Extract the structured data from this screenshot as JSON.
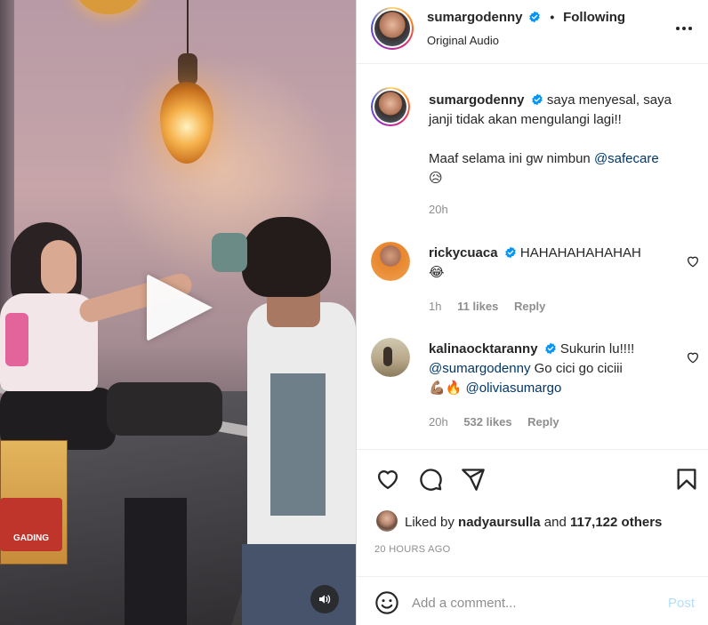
{
  "media": {
    "box_text": "GADING",
    "controls": {
      "play_icon": "play-icon",
      "audio_icon": "speaker-icon"
    }
  },
  "header": {
    "username": "sumargodenny",
    "separator": "•",
    "follow_status": "Following",
    "audio": "Original Audio",
    "more_icon": "more-horizontal-icon"
  },
  "caption": {
    "username": "sumargodenny",
    "text_line1": "saya menyesal, saya janji tidak akan mengulangi lagi!!",
    "text_line2": "Maaf selama ini gw nimbun",
    "mention": "@safecare",
    "emoji": "😥",
    "time": "20h"
  },
  "comments": [
    {
      "username": "rickycuaca",
      "text": "HAHAHAHAHAHAH",
      "emoji": "😂",
      "time": "1h",
      "likes": "11 likes",
      "reply": "Reply"
    },
    {
      "username": "kalinaocktaranny",
      "text": "Sukurin lu!!!!",
      "mention1": "@sumargodenny",
      "text2": "Go cici go ciciii",
      "emoji": "💪🏽🔥",
      "mention2": "@oliviasumargo",
      "time": "20h",
      "likes": "532 likes",
      "reply": "Reply"
    }
  ],
  "actions": {
    "icons": [
      "heart-icon",
      "comment-icon",
      "share-icon",
      "bookmark-icon"
    ]
  },
  "likes_summary": {
    "prefix": "Liked by",
    "liker": "nadyaursulla",
    "conjunction": "and",
    "others": "117,122 others"
  },
  "post_time": "20 HOURS AGO",
  "add_comment": {
    "placeholder": "Add a comment...",
    "post_label": "Post"
  },
  "colors": {
    "verified": "#0095f6",
    "link": "#00376b",
    "muted": "#8e8e8e",
    "post_disabled": "#b2dffc"
  }
}
